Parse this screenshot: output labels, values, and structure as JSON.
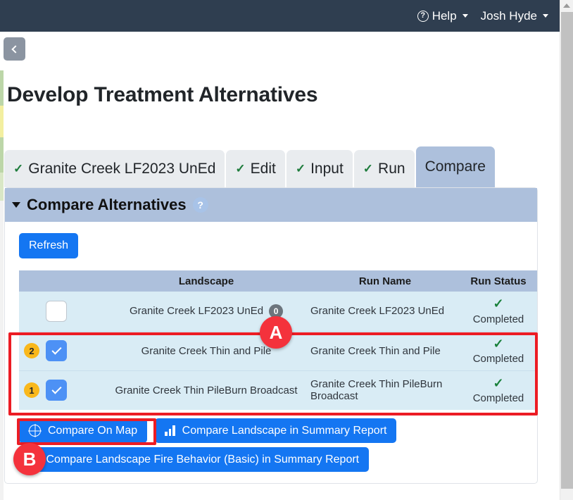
{
  "navbar": {
    "help_label": "Help",
    "help_icon": "question-circle-icon",
    "user_label": "Josh Hyde"
  },
  "collapse_button": {
    "icon": "chevron-left-icon"
  },
  "page": {
    "title": "Develop Treatment Alternatives"
  },
  "tabs": [
    {
      "label": "Granite Creek LF2023 UnEd",
      "check": "✓",
      "active": false
    },
    {
      "label": "Edit",
      "check": "✓",
      "active": false
    },
    {
      "label": "Input",
      "check": "✓",
      "active": false
    },
    {
      "label": "Run",
      "check": "✓",
      "active": false
    },
    {
      "label": "Compare",
      "check": "",
      "active": true
    }
  ],
  "panel": {
    "title": "Compare Alternatives",
    "help_badge": "?",
    "collapse_icon": "chevron-down-icon",
    "refresh_label": "Refresh"
  },
  "table": {
    "headers": [
      "",
      "Landscape",
      "Run Name",
      "Run Status"
    ],
    "rows": [
      {
        "order": "",
        "checked": false,
        "landscape": "Granite Creek LF2023 UnEd",
        "count_badge": "0",
        "run_name": "Granite Creek LF2023 UnEd",
        "status_check": "✓",
        "status": "Completed"
      },
      {
        "order": "2",
        "checked": true,
        "landscape": "Granite Creek Thin and Pile",
        "count_badge": "",
        "run_name": "Granite Creek Thin and Pile",
        "status_check": "✓",
        "status": "Completed"
      },
      {
        "order": "1",
        "checked": true,
        "landscape": "Granite Creek Thin PileBurn Broadcast",
        "count_badge": "",
        "run_name": "Granite Creek Thin PileBurn Broadcast",
        "status_check": "✓",
        "status": "Completed"
      }
    ]
  },
  "actions": {
    "compare_on_map": "Compare On Map",
    "compare_on_map_icon": "globe-icon",
    "compare_landscape_summary": "Compare Landscape in Summary Report",
    "compare_landscape_summary_icon": "bar-chart-icon",
    "compare_fire_behavior": "Compare Landscape Fire Behavior (Basic) in Summary Report",
    "compare_fire_behavior_icon": "bar-chart-icon"
  },
  "annotations": [
    {
      "label": "A",
      "target": "selected-alternative-rows"
    },
    {
      "label": "B",
      "target": "compare-on-map-button"
    }
  ],
  "colors": {
    "navbar_bg": "#2f3e50",
    "accent_blue": "#1476f2",
    "panel_header": "#adc0dc",
    "row_bg": "#d9ecf5",
    "order_badge": "#f9b81c",
    "annotation_red": "#ec1c24",
    "status_green": "#18803a"
  }
}
